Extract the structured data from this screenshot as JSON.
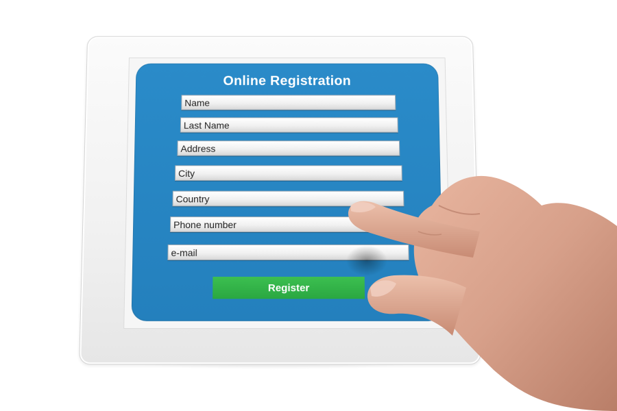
{
  "form": {
    "title": "Online Registration",
    "fields": [
      {
        "label": "Name"
      },
      {
        "label": "Last Name"
      },
      {
        "label": "Address"
      },
      {
        "label": "City"
      },
      {
        "label": "Country"
      },
      {
        "label": "Phone number"
      },
      {
        "label": "e-mail"
      }
    ],
    "submit_label": "Register"
  },
  "colors": {
    "screen_blue": "#2a8bc9",
    "button_green": "#2aa741",
    "tablet_white": "#f4f4f4",
    "skin": "#d7a08a"
  },
  "icons": {
    "hand": "pointing-hand-icon"
  }
}
